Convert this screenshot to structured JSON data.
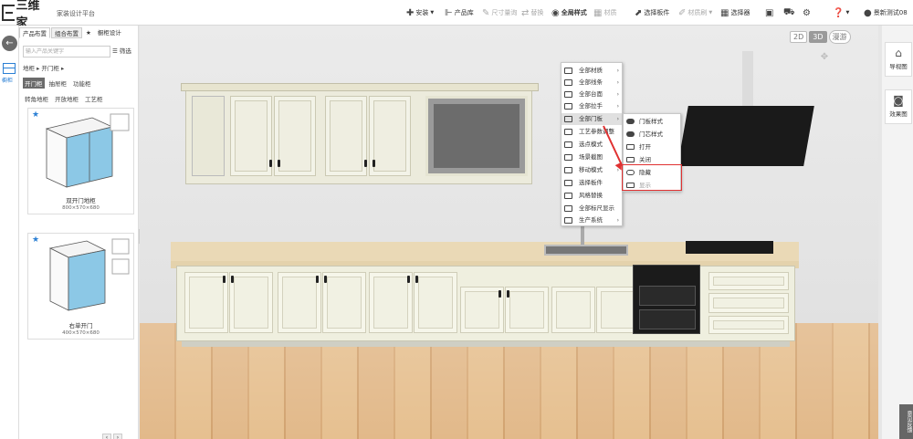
{
  "header": {
    "logo_text": "三维家",
    "platform": "家装设计平台",
    "tools": [
      {
        "label": "安装",
        "icon": "plus-icon",
        "dropdown": true,
        "enabled": true
      },
      {
        "label": "产品库",
        "icon": "product-library-icon",
        "enabled": true
      },
      {
        "label": "尺寸量询",
        "icon": "ruler-icon",
        "enabled": false
      },
      {
        "label": "替换",
        "icon": "replace-icon",
        "enabled": false
      },
      {
        "label": "全局样式",
        "icon": "global-style-icon",
        "enabled": true
      },
      {
        "label": "材质",
        "icon": "material-icon",
        "enabled": false
      },
      {
        "label": "选择板件",
        "icon": "select-panel-icon",
        "enabled": true
      },
      {
        "label": "材质刷",
        "icon": "brush-icon",
        "dropdown": true,
        "enabled": false
      },
      {
        "label": "选择器",
        "icon": "selector-icon",
        "enabled": true
      }
    ],
    "username": "景新测试08"
  },
  "left_rail": {
    "label": "橱柜"
  },
  "left_panel": {
    "tabs": [
      "产品布置",
      "组合布置",
      "★",
      "橱柜设计"
    ],
    "active_tab": 0,
    "search_placeholder": "输入产品关键字",
    "filter_label": "筛选",
    "breadcrumb": "地柜 ▸  开门柜 ▸",
    "categories": [
      "开门柜",
      "抽屉柜",
      "功能柜",
      "转角地柜",
      "开放地柜",
      "工艺柜"
    ],
    "active_category": 0,
    "products": [
      {
        "name": "双开门地柜",
        "dims": "800×570×680"
      },
      {
        "name": "右单开门",
        "dims": "400×570×680"
      }
    ]
  },
  "view_controls": {
    "labels": [
      "2D",
      "3D",
      "漫游"
    ],
    "active": 1
  },
  "right_rail": [
    {
      "label": "导视图",
      "icon": "home-icon"
    },
    {
      "label": "效果图",
      "icon": "camera-icon"
    }
  ],
  "feedback_label": "意见反馈",
  "context_menu": {
    "items": [
      {
        "label": "全部材质",
        "has_submenu": true
      },
      {
        "label": "全部线条",
        "has_submenu": true
      },
      {
        "label": "全部台面",
        "has_submenu": true
      },
      {
        "label": "全部拉手",
        "has_submenu": true
      },
      {
        "label": "全部门板",
        "has_submenu": true,
        "highlighted": true
      },
      {
        "label": "工艺参数调整",
        "has_submenu": false
      },
      {
        "label": "选点模式",
        "has_submenu": false
      },
      {
        "label": "场景截图",
        "has_submenu": false
      },
      {
        "label": "移动模式",
        "has_submenu": true
      },
      {
        "label": "选择板件",
        "has_submenu": false
      },
      {
        "label": "风格替换",
        "has_submenu": false
      },
      {
        "label": "全部标尺显示",
        "has_submenu": false
      },
      {
        "label": "生产系统",
        "has_submenu": true
      }
    ],
    "submenu": [
      "门板样式",
      "门芯样式",
      "打开",
      "关闭",
      "隐藏",
      "显示"
    ],
    "highlighted_subitems": [
      "隐藏",
      "显示"
    ]
  }
}
